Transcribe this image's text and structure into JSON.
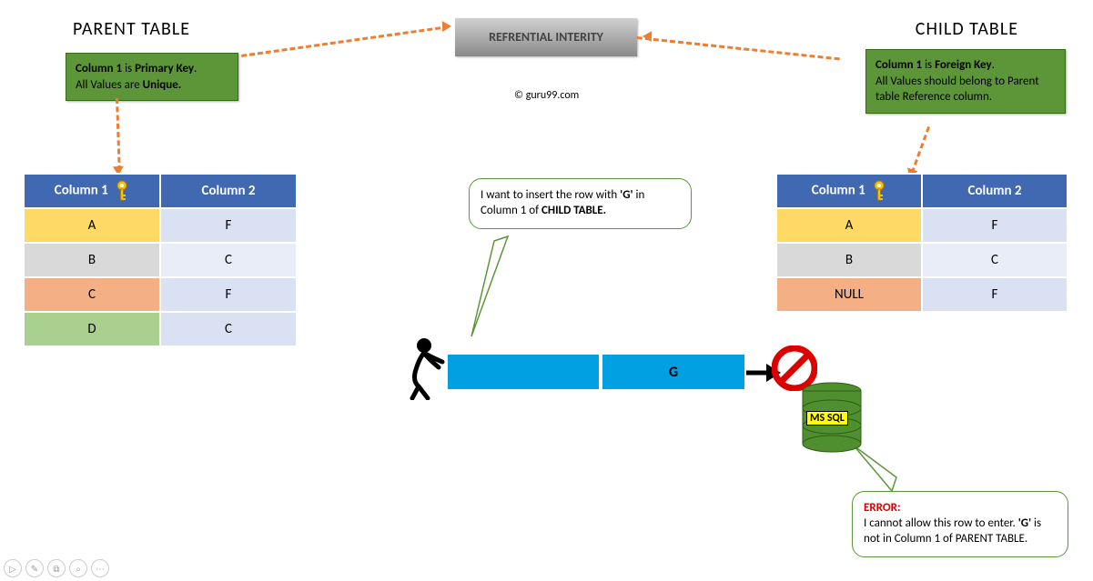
{
  "titles": {
    "parent": "PARENT TABLE",
    "child": "CHILD TABLE",
    "banner": "REFRENTIAL INTERITY",
    "copyright": "© guru99.com"
  },
  "notes": {
    "left_html": "<b>Column 1</b> is <b>Primary Key</b>.<br>All Values are <b>Unique.</b>",
    "right_html": "<b>Column 1</b> is <b>Foreign Key</b>.<br>All Values should belong to Parent table Reference column."
  },
  "parent_table": {
    "headers": [
      "Column 1",
      "Column 2"
    ],
    "rows": [
      {
        "c1": "A",
        "c2": "F",
        "cls": "row-yellow"
      },
      {
        "c1": "B",
        "c2": "C",
        "cls": "row-gray"
      },
      {
        "c1": "C",
        "c2": "F",
        "cls": "row-orange"
      },
      {
        "c1": "D",
        "c2": "C",
        "cls": "row-green"
      }
    ]
  },
  "child_table": {
    "headers": [
      "Column 1",
      "Column 2"
    ],
    "rows": [
      {
        "c1": "A",
        "c2": "F",
        "cls": "row-yellow"
      },
      {
        "c1": "B",
        "c2": "C",
        "cls": "row-gray"
      },
      {
        "c1": "NULL",
        "c2": "F",
        "cls": "row-orange"
      }
    ]
  },
  "speech": {
    "insert_html": "I want to insert the row with <b>'G'</b> in Column 1 of <b>CHILD TABLE.</b>",
    "error_html": "<span class='err'>ERROR:</span><br>I cannot allow this row to enter. <b>'G'</b> is not in Column 1 of PARENT TABLE."
  },
  "insert_row": {
    "c1": "",
    "c2": "G"
  },
  "db_label": "MS SQL"
}
